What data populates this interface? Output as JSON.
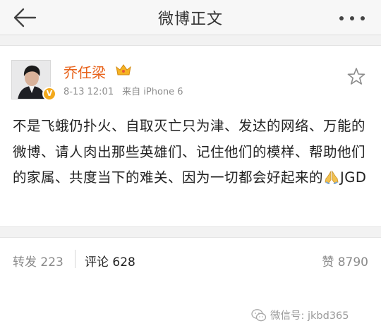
{
  "nav": {
    "title": "微博正文",
    "back_icon": "back-arrow-icon",
    "more_icon": "more-dots-icon"
  },
  "post": {
    "author": "乔任梁",
    "verified": true,
    "timestamp": "8-13 12:01",
    "source_prefix": "来自",
    "source": "iPhone 6",
    "text_main": "不是飞蛾仍扑火、自取灭亡只为津、发达的网络、万能的微博、请人肉出那些英雄们、记住他们的模样、帮助他们的家属、共度当下的难关、因为一切都会好起来的",
    "text_tail": "JGD",
    "emoji": "pray-hands-icon"
  },
  "actions": {
    "repost": "转发 223",
    "comment": "评论 628",
    "like": "赞 8790"
  },
  "watermark": "微信号: jkbd365",
  "colors": {
    "username": "#e8621a",
    "meta": "#8d8d8d",
    "text": "#222222",
    "background": "#f2f2f2"
  }
}
